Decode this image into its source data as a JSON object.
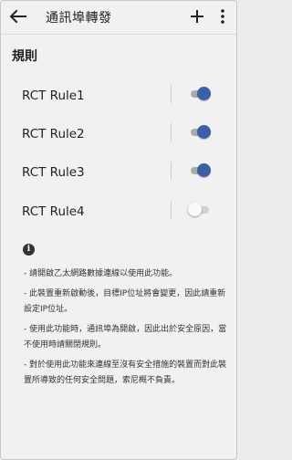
{
  "header": {
    "title": "通訊埠轉發",
    "back_icon": "arrow-left-icon",
    "add_icon": "plus-icon",
    "more_icon": "more-vertical-icon"
  },
  "section": {
    "title": "規則"
  },
  "rules": [
    {
      "label": "RCT Rule1",
      "enabled": true
    },
    {
      "label": "RCT Rule2",
      "enabled": true
    },
    {
      "label": "RCT Rule3",
      "enabled": true
    },
    {
      "label": "RCT Rule4",
      "enabled": false
    }
  ],
  "info": {
    "icon": "info-icon",
    "icon_glyph": "i",
    "notes": [
      "- 請開啟乙太網路數據連線以使用此功能。",
      "- 此裝置重新啟動後，目標IP位址將會變更，因此請重新設定IP位址。",
      "- 使用此功能時，通訊埠為開啟，因此出於安全原因，當不使用時請關閉規則。",
      "- 對於使用此功能來連線至沒有安全措施的裝置而對此裝置所導致的任何安全問題，索尼概不負責。"
    ]
  },
  "colors": {
    "toggle_on_thumb": "#3d5fa5",
    "toggle_on_track": "#aaaaaa",
    "toggle_off_thumb": "#fafafa",
    "background": "#f1f1f1"
  }
}
